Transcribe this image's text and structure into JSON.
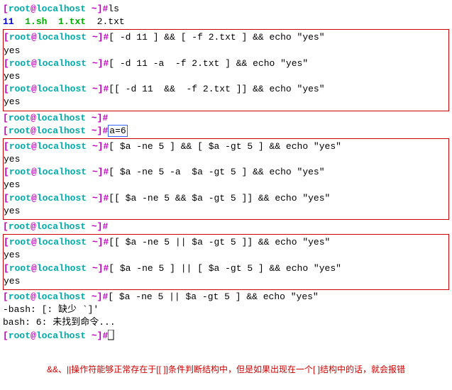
{
  "prompt_full": "[root@localhost ~]#",
  "user": "root",
  "host": "localhost",
  "path": "~",
  "ls_cmd": "ls",
  "ls_items": {
    "dir": "11",
    "script": "1.sh",
    "green_txt": "1.txt",
    "txt": "2.txt"
  },
  "block1": {
    "cmd1": "[ -d 11 ] && [ -f 2.txt ] && echo \"yes\"",
    "out1": "yes",
    "cmd2": "[ -d 11 -a  -f 2.txt ] && echo \"yes\"",
    "out2": "yes",
    "cmd3": "[[ -d 11  &&  -f 2.txt ]] && echo \"yes\"",
    "out3": "yes"
  },
  "assign": "a=6",
  "block2": {
    "cmd1": "[ $a -ne 5 ] && [ $a -gt 5 ] && echo \"yes\"",
    "out1": "yes",
    "cmd2": "[ $a -ne 5 -a  $a -gt 5 ] && echo \"yes\"",
    "out2": "yes",
    "cmd3": "[[ $a -ne 5 && $a -gt 5 ]] && echo \"yes\"",
    "out3": "yes"
  },
  "block3": {
    "cmd1": "[[ $a -ne 5 || $a -gt 5 ]] && echo \"yes\"",
    "out1": "yes",
    "cmd2": "[ $a -ne 5 ] || [ $a -gt 5 ] && echo \"yes\"",
    "out2": "yes"
  },
  "errcmd": "[ $a -ne 5 || $a -gt 5 ] && echo \"yes\"",
  "err1": "-bash: [: 缺少 `]'",
  "err2": "bash: 6: 未找到命令...",
  "footnote": "&&、||操作符能够正常存在于[[ ]]条件判断结构中，但是如果出现在一个[ ]结构中的话，就会报错"
}
